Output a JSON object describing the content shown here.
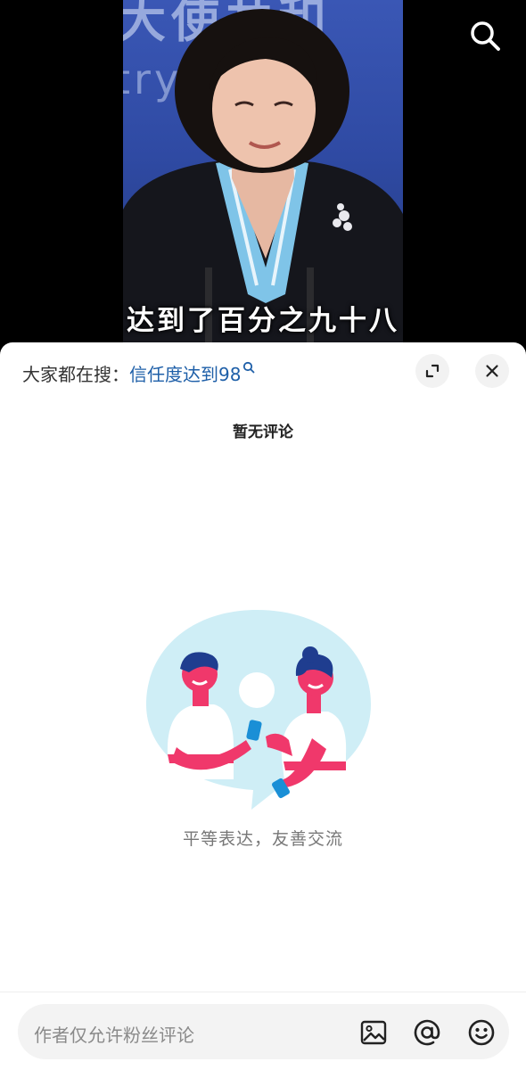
{
  "video": {
    "backdrop_text": "大使共和",
    "backdrop_text2": "try ore",
    "subtitle": "达到了百分之九十八"
  },
  "comments_panel": {
    "hot_search_label": "大家都在搜：",
    "hot_search_query": "信任度达到98",
    "empty_title": "暂无评论",
    "empty_tagline": "平等表达，友善交流"
  },
  "comment_bar": {
    "placeholder": "作者仅允许粉丝评论"
  },
  "icons": {
    "top_search": "search-icon",
    "expand": "expand-icon",
    "close": "close-icon",
    "image": "image-icon",
    "mention": "at-icon",
    "emoji": "emoji-icon"
  },
  "colors": {
    "link_blue": "#1e5fa8",
    "illustration_bubble": "#cfeef6",
    "illustration_accent": "#f0386b",
    "video_backdrop": "#2f4aa3"
  }
}
